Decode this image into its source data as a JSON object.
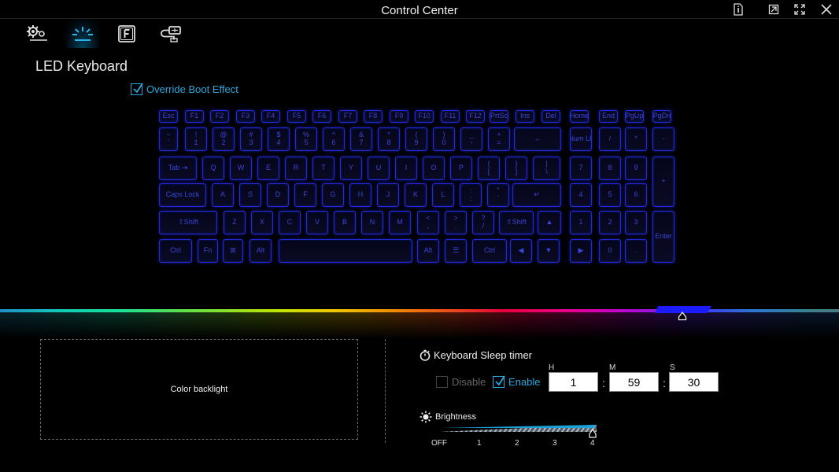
{
  "window": {
    "title": "Control Center"
  },
  "page": {
    "title": "LED Keyboard",
    "override_label": "Override Boot Effect",
    "override_checked": true
  },
  "keyboard": {
    "rows": [
      [
        "Esc",
        "F1",
        "F2",
        "F3",
        "F4",
        "F5",
        "F6",
        "F7",
        "F8",
        "F9",
        "F10",
        "F11",
        "F12",
        "PrtSc",
        "Ins",
        "Del",
        "Home",
        "End",
        "PgUp",
        "PgDn"
      ],
      [
        "~\n`",
        "!\n1",
        "@\n2",
        "#\n3",
        "$\n4",
        "%\n5",
        "^\n6",
        "&\n7",
        "*\n8",
        "(\n9",
        ")\n0",
        "_\n-",
        "+\n=",
        "←",
        "Num Lk",
        "/",
        "*",
        "-"
      ],
      [
        "Tab ⇥",
        "Q",
        "W",
        "E",
        "R",
        "T",
        "Y",
        "U",
        "I",
        "O",
        "P",
        "{\n[",
        "}\n]",
        "|\n\\",
        "7",
        "8",
        "9",
        "+"
      ],
      [
        "Caps Lock",
        "A",
        "S",
        "D",
        "F",
        "G",
        "H",
        "J",
        "K",
        "L",
        ":\n;",
        "\"\n'",
        "↵",
        "4",
        "5",
        "6"
      ],
      [
        "⇧Shift",
        "Z",
        "X",
        "C",
        "V",
        "B",
        "N",
        "M",
        "<\n,",
        ">\n.",
        "?\n/",
        "⇧Shift",
        "▲",
        "1",
        "2",
        "3",
        "Enter"
      ],
      [
        "Ctrl",
        "Fn",
        "⊞",
        "Alt",
        "",
        "Alt",
        "☰",
        "Ctrl",
        "◀",
        "▼",
        "▶",
        "0",
        "."
      ]
    ]
  },
  "color_backlight": {
    "label": "Color backlight",
    "selected_color": "#1b1cff"
  },
  "sleep_timer": {
    "title": "Keyboard Sleep timer",
    "disable_label": "Disable",
    "enable_label": "Enable",
    "enabled": true,
    "h_label": "H",
    "m_label": "M",
    "s_label": "S",
    "hours": "1",
    "minutes": "59",
    "seconds": "30",
    "separator": ":"
  },
  "brightness": {
    "title": "Brightness",
    "ticks": [
      "OFF",
      "1",
      "2",
      "3",
      "4"
    ],
    "value": 4,
    "accent": "#1aa3d8"
  },
  "tabs": [
    {
      "icon": "system-settings-icon"
    },
    {
      "icon": "led-keyboard-icon",
      "active": true
    },
    {
      "icon": "function-key-icon"
    },
    {
      "icon": "usb-device-icon"
    }
  ]
}
